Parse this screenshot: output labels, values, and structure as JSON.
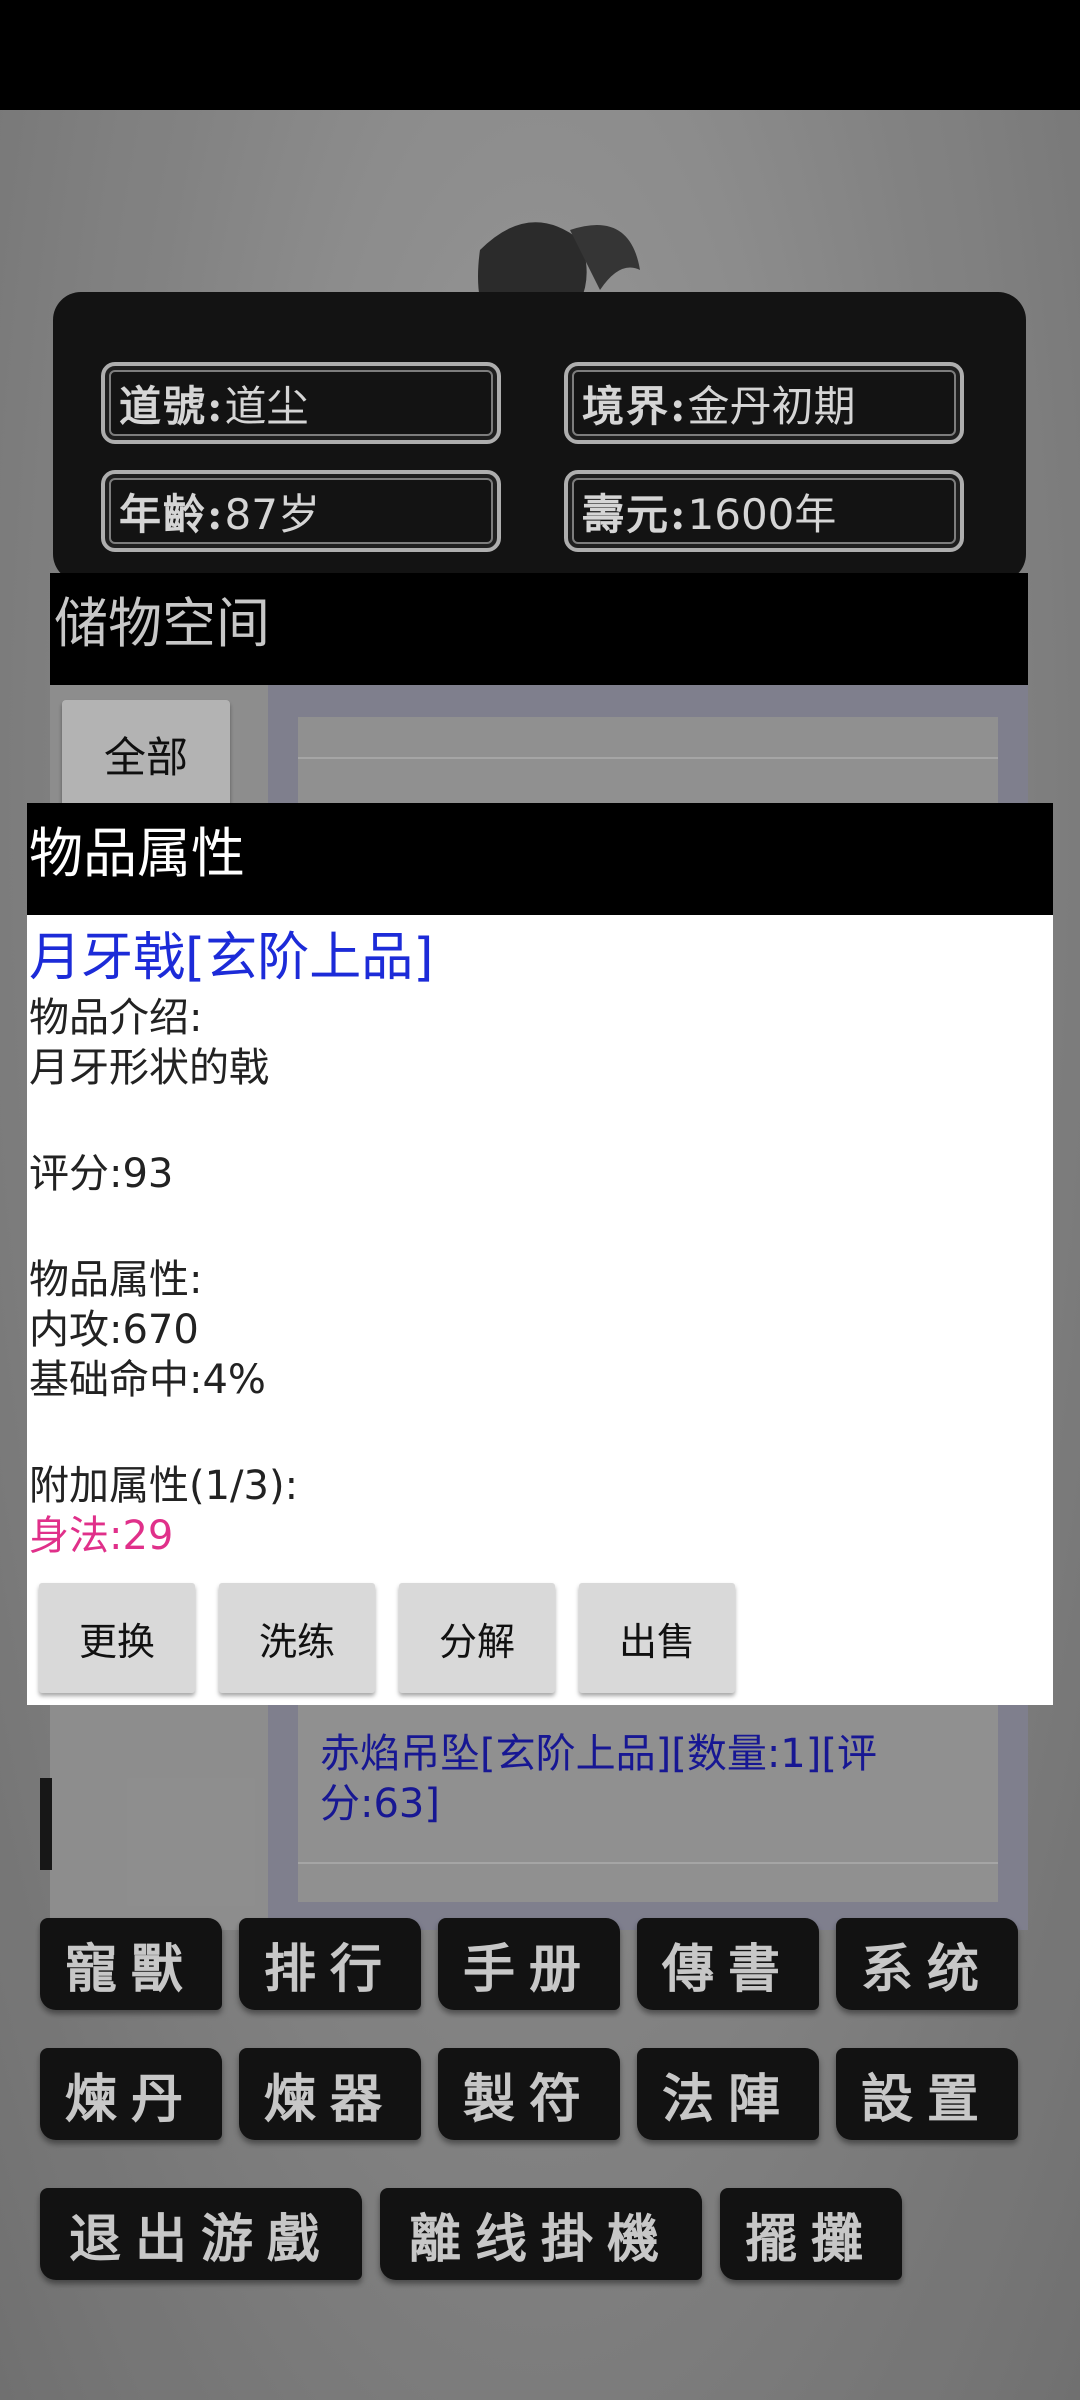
{
  "character": {
    "dao_name_label": "道號:",
    "dao_name_value": "道尘",
    "realm_label": "境界:",
    "realm_value": "金丹初期",
    "age_label": "年齡:",
    "age_value": "87岁",
    "lifespan_label": "壽元:",
    "lifespan_value": "1600年"
  },
  "storage": {
    "title": "储物空间",
    "filter_all": "全部",
    "visible_item": "赤焰吊坠[玄阶上品][数量:1][评分:63]"
  },
  "modal": {
    "title": "物品属性",
    "item_name": "月牙戟[玄阶上品]",
    "intro_label": "物品介绍:",
    "intro_text": "月牙形状的戟",
    "score": "评分:93",
    "attributes_label": "物品属性:",
    "attr_1": "内攻:670",
    "attr_2": "基础命中:4%",
    "extra_label": "附加属性(1/3):",
    "extra_1": "身法:29",
    "buttons": {
      "replace": "更换",
      "refine": "洗练",
      "decompose": "分解",
      "sell": "出售"
    }
  },
  "menu": {
    "pet": "寵獸",
    "ranking": "排行",
    "manual": "手册",
    "message": "傳書",
    "system": "系统",
    "alchemy": "煉丹",
    "forge": "煉器",
    "talisman": "製符",
    "formation": "法陣",
    "settings": "設置",
    "exit_game": "退出游戲",
    "offline_idle": "離线掛機",
    "stall": "擺攤"
  },
  "colors": {
    "item_name": "#1c2bd8",
    "extra_attribute": "#e0308a",
    "storage_item": "#1a1aa0"
  }
}
